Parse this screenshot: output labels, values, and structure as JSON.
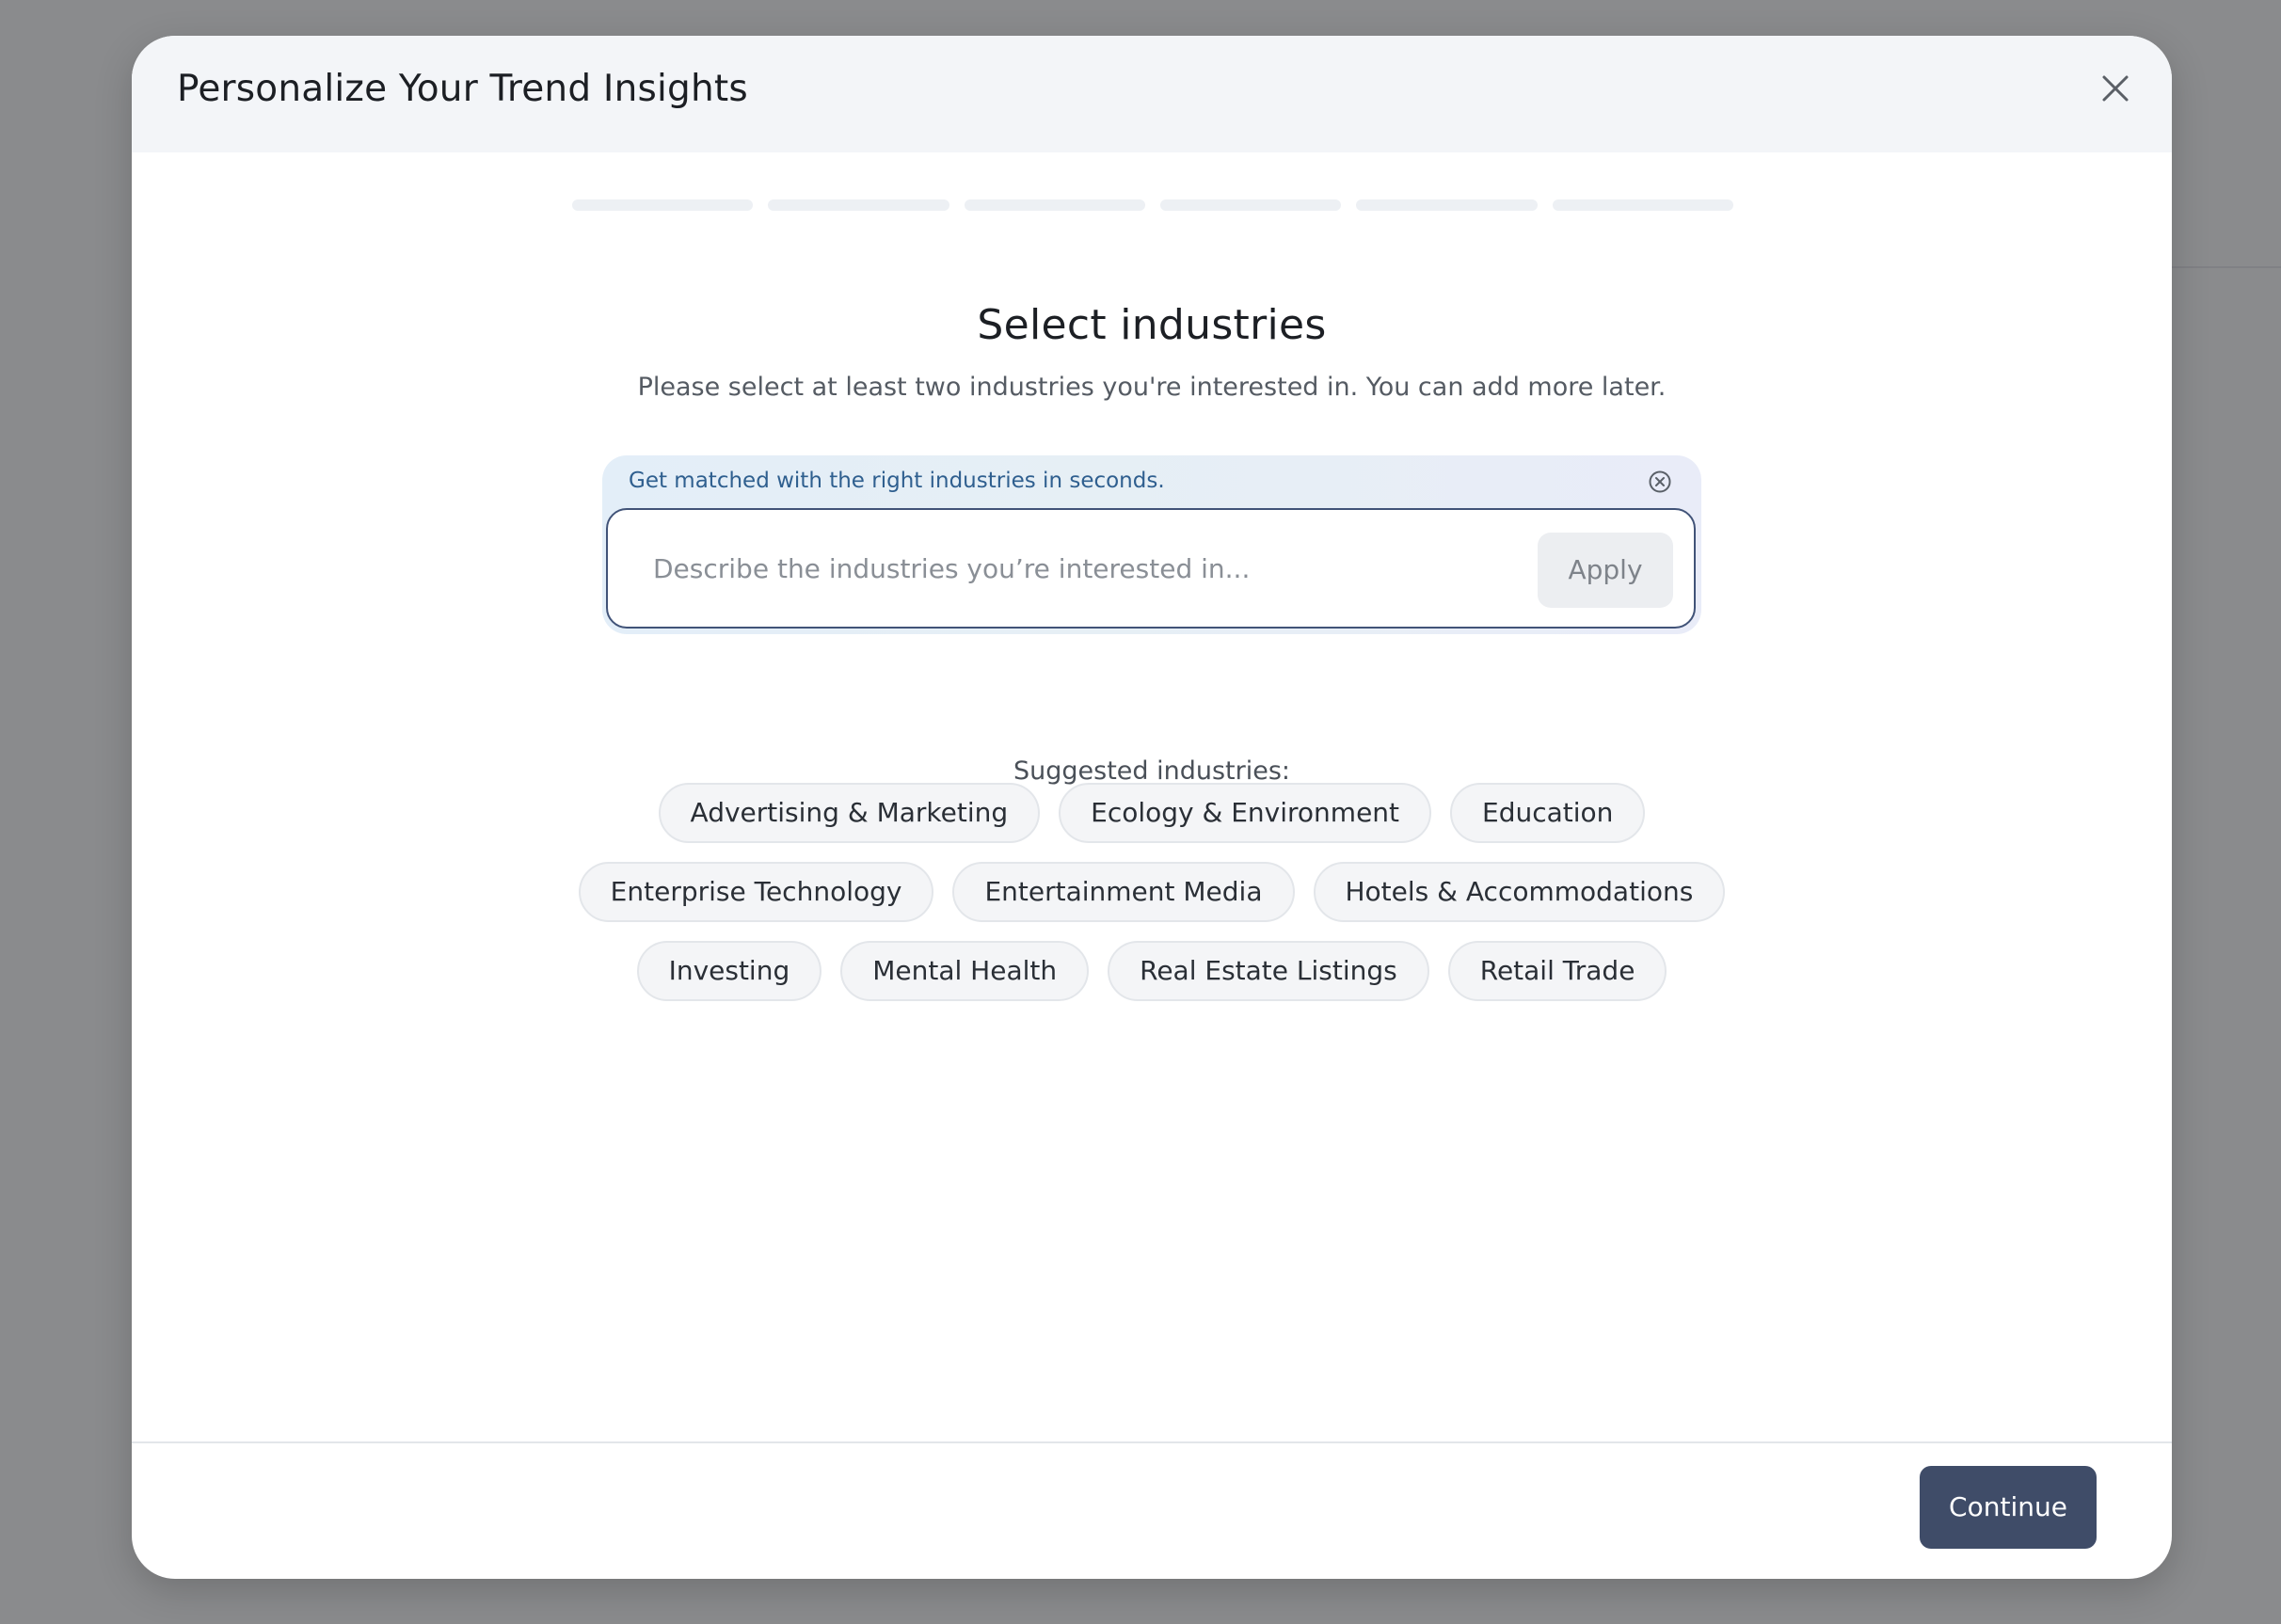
{
  "modal": {
    "title": "Personalize Your Trend Insights",
    "close_icon": "close-icon",
    "progress_steps": 6
  },
  "step": {
    "title": "Select industries",
    "subtitle": "Please select at least two industries you're interested in. You can add more later."
  },
  "ai_assist": {
    "hint": "Get matched with the right industries in seconds.",
    "dismiss_icon": "circle-x-icon",
    "input_value": "",
    "placeholder": "Describe the industries you’re interested in...",
    "apply_label": "Apply"
  },
  "suggested": {
    "label": "Suggested industries:",
    "rows": [
      [
        "Advertising & Marketing",
        "Ecology & Environment",
        "Education"
      ],
      [
        "Enterprise Technology",
        "Entertainment Media",
        "Hotels & Accommodations"
      ],
      [
        "Investing",
        "Mental Health",
        "Real Estate Listings",
        "Retail Trade"
      ]
    ]
  },
  "footer": {
    "continue_label": "Continue"
  },
  "colors": {
    "accent": "#3f4c68",
    "header_bg": "#f3f5f8",
    "hint_text": "#2f5f8f",
    "overlay": "#8a8b8d"
  }
}
